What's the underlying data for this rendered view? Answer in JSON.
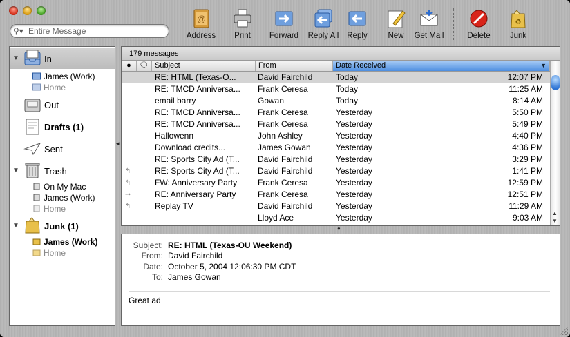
{
  "search": {
    "placeholder": "Entire Message",
    "icon": "magnifier-icon"
  },
  "toolbar": [
    {
      "name": "address",
      "label": "Address",
      "icon": "address-book-icon"
    },
    {
      "name": "print",
      "label": "Print",
      "icon": "printer-icon"
    },
    {
      "name": "forward",
      "label": "Forward",
      "icon": "forward-icon"
    },
    {
      "name": "reply-all",
      "label": "Reply All",
      "icon": "reply-all-icon"
    },
    {
      "name": "reply",
      "label": "Reply",
      "icon": "reply-icon"
    },
    {
      "name": "new",
      "label": "New",
      "icon": "compose-icon"
    },
    {
      "name": "get-mail",
      "label": "Get Mail",
      "icon": "get-mail-icon"
    },
    {
      "name": "delete",
      "label": "Delete",
      "icon": "delete-icon"
    },
    {
      "name": "junk",
      "label": "Junk",
      "icon": "junk-icon"
    }
  ],
  "mailboxes": {
    "in": {
      "label": "In",
      "accounts": [
        "James (Work)",
        "Home"
      ]
    },
    "out": {
      "label": "Out"
    },
    "drafts": {
      "label": "Drafts (1)"
    },
    "sent": {
      "label": "Sent"
    },
    "trash": {
      "label": "Trash",
      "accounts": [
        "On My Mac",
        "James (Work)",
        "Home"
      ]
    },
    "junk": {
      "label": "Junk (1)",
      "accounts": [
        "James (Work)",
        "Home"
      ]
    }
  },
  "list": {
    "count": "179 messages",
    "columns": {
      "subject": "Subject",
      "from": "From",
      "date": "Date Received"
    },
    "rows": [
      {
        "status": "",
        "subject": "RE: HTML (Texas-O...",
        "from": "David Fairchild",
        "day": "Today",
        "time": "12:07 PM"
      },
      {
        "status": "",
        "subject": "RE: TMCD Anniversa...",
        "from": "Frank Ceresa",
        "day": "Today",
        "time": "11:25 AM"
      },
      {
        "status": "",
        "subject": "email barry",
        "from": "Gowan",
        "day": "Today",
        "time": "8:14 AM"
      },
      {
        "status": "",
        "subject": "RE: TMCD Anniversa...",
        "from": "Frank Ceresa",
        "day": "Yesterday",
        "time": "5:50 PM"
      },
      {
        "status": "",
        "subject": "RE: TMCD Anniversa...",
        "from": "Frank Ceresa",
        "day": "Yesterday",
        "time": "5:49 PM"
      },
      {
        "status": "",
        "subject": "Hallowenn",
        "from": "John Ashley",
        "day": "Yesterday",
        "time": "4:40 PM"
      },
      {
        "status": "",
        "subject": "Download credits...",
        "from": "James Gowan",
        "day": "Yesterday",
        "time": "4:36 PM"
      },
      {
        "status": "",
        "subject": "RE: Sports City Ad (T...",
        "from": "David Fairchild",
        "day": "Yesterday",
        "time": "3:29 PM"
      },
      {
        "status": "↰",
        "subject": "RE: Sports City Ad (T...",
        "from": "David Fairchild",
        "day": "Yesterday",
        "time": "1:41 PM"
      },
      {
        "status": "↰",
        "subject": "FW: Anniversary Party",
        "from": "Frank Ceresa",
        "day": "Yesterday",
        "time": "12:59 PM"
      },
      {
        "status": "➙",
        "subject": "RE: Anniversary Party",
        "from": "Frank Ceresa",
        "day": "Yesterday",
        "time": "12:51 PM"
      },
      {
        "status": "↰",
        "subject": "Replay TV",
        "from": "David Fairchild",
        "day": "Yesterday",
        "time": "11:29 AM"
      },
      {
        "status": "",
        "subject": "",
        "from": "Lloyd Ace",
        "day": "Yesterday",
        "time": "9:03 AM"
      }
    ]
  },
  "preview": {
    "labels": {
      "subject": "Subject:",
      "from": "From:",
      "date": "Date:",
      "to": "To:"
    },
    "subject": "RE: HTML (Texas-OU Weekend)",
    "from": "David Fairchild",
    "date": "October 5, 2004 12:06:30 PM CDT",
    "to": "James Gowan",
    "body": "Great ad"
  },
  "colors": {
    "sort_column": "#4d8ee0",
    "selection": "#d4d4d4",
    "junk_icon_yellow": "#e8c04a"
  }
}
